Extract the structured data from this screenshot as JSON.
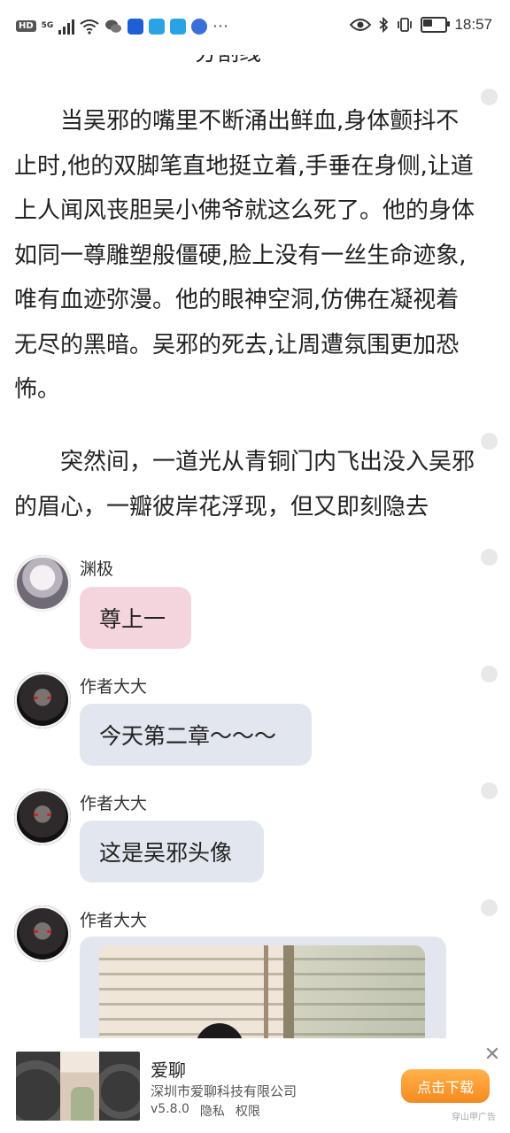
{
  "status_bar": {
    "hd": "HD",
    "network": "5G",
    "more": "···",
    "time": "18:57",
    "battery_level": 0.5,
    "icons": [
      "hd-icon",
      "signal-icon",
      "wifi-icon",
      "wechat-icon",
      "shield-app-icon",
      "edge-app-icon",
      "edge-app-icon-2",
      "browser-icon",
      "eye-icon",
      "bluetooth-icon",
      "vibrate-icon",
      "battery-icon"
    ]
  },
  "reader": {
    "separator": "——————分割线——————",
    "paragraphs": [
      "当吴邪的嘴里不断涌出鲜血,身体颤抖不止时,他的双脚笔直地挺立着,手垂在身侧,让道上人闻风丧胆吴小佛爷就这么死了。他的身体如同一尊雕塑般僵硬,脸上没有一丝生命迹象,唯有血迹弥漫。他的眼神空洞,仿佛在凝视着无尽的黑暗。吴邪的死去,让周遭氛围更加恐怖。",
      "突然间，一道光从青铜门内飞出没入吴邪的眉心，一瓣彼岸花浮现，但又即刻隐去"
    ]
  },
  "comments": [
    {
      "user": "渊极",
      "text": "尊上一",
      "style": "pink"
    },
    {
      "user": "作者大大",
      "text": "今天第二章～～～",
      "style": "grey"
    },
    {
      "user": "作者大大",
      "text": "这是吴邪头像",
      "style": "grey"
    },
    {
      "user": "作者大大",
      "text": "",
      "style": "image"
    }
  ],
  "ad": {
    "title": "爱聊",
    "company": "深圳市爱聊科技有限公司",
    "version": "v5.8.0",
    "privacy": "隐私",
    "permissions": "权限",
    "button": "点击下载",
    "close": "✕",
    "source": "穿山甲广告",
    "button_color": "#f5962a"
  },
  "colors": {
    "pink_bubble": "#f5d5dd",
    "grey_bubble": "#e2e7ef"
  }
}
